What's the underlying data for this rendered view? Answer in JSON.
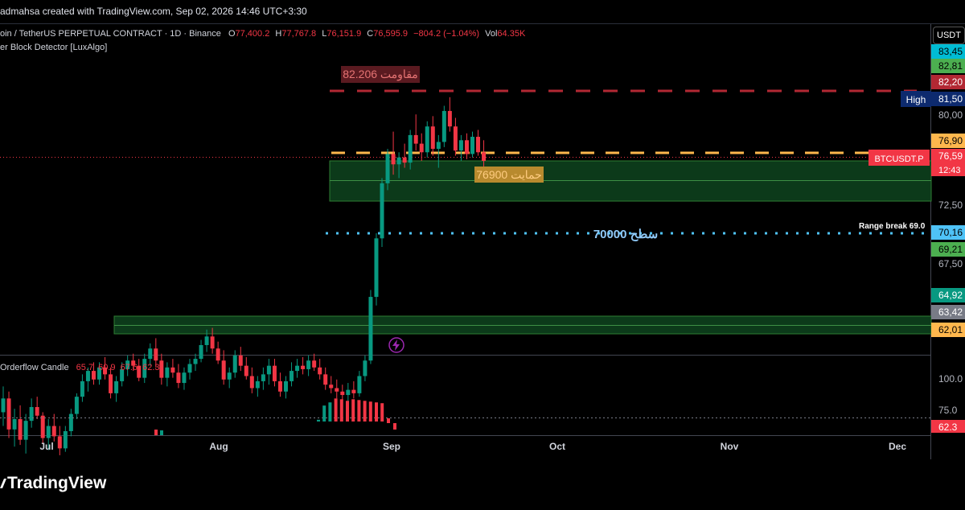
{
  "header": {
    "credit": "admahsa created with TradingView.com, Sep 02, 2026 14:46 UTC+3:30"
  },
  "symbol_line": {
    "title": "oin / TetherUS PERPETUAL CONTRACT · 1D · Binance",
    "o_label": "O",
    "o_value": "77,400.2",
    "h_label": "H",
    "h_value": "77,767.8",
    "l_label": "L",
    "l_value": "76,151.9",
    "c_label": "C",
    "c_value": "76,595.9",
    "change": "−804.2 (−1.04%)",
    "vol_label": "Vol",
    "vol_value": "64.35K"
  },
  "indicator1": {
    "name": "er Block Detector [LuxAlgo]"
  },
  "currency_button": "USDT",
  "annotations": {
    "resistance": "مقاومت 82.206",
    "support": "حمایت 76900",
    "level": "سطح 70000",
    "range_break": "Range break 69.0",
    "high": "High",
    "symbol_tag": "BTCUSDT.P",
    "countdown": "12:43"
  },
  "price_axis": {
    "labels": [
      {
        "text": "83,45",
        "bg": "#00bcd4",
        "fg": "#000000"
      },
      {
        "text": "82,81",
        "bg": "#4caf50",
        "fg": "#000000"
      },
      {
        "text": "82,20",
        "bg": "#b22833",
        "fg": "#ffffff"
      },
      {
        "text": "81,50",
        "bg": "#0d2a6e",
        "fg": "#ffffff"
      },
      {
        "text": "80,00",
        "bg": "",
        "fg": "#b2b5be"
      },
      {
        "text": "76,90",
        "bg": "#ffb74d",
        "fg": "#000000"
      },
      {
        "text": "76,59",
        "bg": "#f23645",
        "fg": "#ffffff"
      },
      {
        "text": "72,50",
        "bg": "",
        "fg": "#b2b5be"
      },
      {
        "text": "70,16",
        "bg": "#4fc3f7",
        "fg": "#000000"
      },
      {
        "text": "69,21",
        "bg": "#4caf50",
        "fg": "#000000"
      },
      {
        "text": "67,50",
        "bg": "",
        "fg": "#b2b5be"
      },
      {
        "text": "64,92",
        "bg": "#089981",
        "fg": "#ffffff"
      },
      {
        "text": "63,42",
        "bg": "#787b86",
        "fg": "#ffffff"
      },
      {
        "text": "62,01",
        "bg": "#ffb74d",
        "fg": "#000000"
      }
    ]
  },
  "lower_pane": {
    "name": "Orderflow Candle",
    "values": [
      "65.7",
      "60.9",
      "67.6",
      "62.3"
    ],
    "axis": [
      "100.0",
      "75.0"
    ],
    "last_value": "62.3"
  },
  "time_axis": [
    "Jul",
    "Aug",
    "Sep",
    "Oct",
    "Nov",
    "Dec"
  ],
  "brand": "TradingView",
  "colors": {
    "bull": "#089981",
    "bear": "#f23645",
    "resistance": "#b22833",
    "support": "#ffb74d",
    "level": "#4fc3f7",
    "zone": "#0c3a1a"
  },
  "icons": {
    "event": "lightning-icon"
  },
  "candles": [
    [
      62.0,
      63.5,
      61.2,
      62.8
    ],
    [
      62.8,
      63.2,
      60.5,
      61.0
    ],
    [
      61.0,
      62.2,
      60.0,
      61.6
    ],
    [
      61.6,
      62.4,
      60.1,
      60.4
    ],
    [
      60.4,
      61.9,
      59.6,
      61.5
    ],
    [
      61.5,
      62.8,
      61.1,
      62.3
    ],
    [
      62.3,
      62.9,
      61.6,
      61.8
    ],
    [
      61.8,
      62.0,
      60.2,
      60.5
    ],
    [
      60.5,
      61.6,
      59.8,
      61.2
    ],
    [
      61.2,
      61.9,
      60.3,
      60.6
    ],
    [
      60.6,
      61.2,
      59.5,
      59.9
    ],
    [
      59.9,
      61.2,
      59.7,
      60.9
    ],
    [
      60.9,
      62.2,
      60.6,
      61.9
    ],
    [
      61.9,
      63.1,
      61.6,
      62.9
    ],
    [
      62.9,
      64.2,
      62.6,
      63.8
    ],
    [
      63.8,
      64.6,
      63.2,
      64.4
    ],
    [
      64.4,
      64.9,
      63.6,
      63.9
    ],
    [
      63.9,
      64.9,
      63.6,
      64.6
    ],
    [
      64.6,
      65.2,
      63.9,
      64.2
    ],
    [
      64.2,
      64.6,
      62.8,
      63.1
    ],
    [
      63.1,
      64.1,
      62.6,
      63.8
    ],
    [
      63.8,
      64.9,
      63.5,
      64.5
    ],
    [
      64.5,
      65.3,
      64.1,
      65.0
    ],
    [
      65.0,
      65.4,
      64.4,
      64.7
    ],
    [
      64.7,
      65.1,
      63.8,
      64.0
    ],
    [
      64.0,
      65.4,
      63.7,
      65.1
    ],
    [
      65.1,
      66.0,
      64.7,
      65.7
    ],
    [
      65.7,
      66.3,
      64.6,
      65.0
    ],
    [
      65.0,
      65.4,
      63.6,
      64.0
    ],
    [
      64.0,
      64.9,
      63.5,
      64.6
    ],
    [
      64.6,
      65.1,
      64.0,
      64.3
    ],
    [
      64.3,
      64.8,
      63.4,
      63.7
    ],
    [
      63.7,
      64.6,
      63.3,
      64.3
    ],
    [
      64.3,
      65.1,
      63.9,
      64.8
    ],
    [
      64.8,
      65.4,
      64.4,
      65.1
    ],
    [
      65.1,
      66.2,
      64.9,
      65.9
    ],
    [
      65.9,
      66.8,
      65.5,
      66.4
    ],
    [
      66.4,
      66.9,
      65.4,
      65.7
    ],
    [
      65.7,
      66.1,
      64.8,
      65.0
    ],
    [
      65.0,
      65.6,
      63.6,
      63.9
    ],
    [
      63.9,
      64.6,
      63.4,
      64.3
    ],
    [
      64.3,
      65.6,
      64.0,
      65.3
    ],
    [
      65.3,
      65.8,
      64.4,
      64.7
    ],
    [
      64.7,
      65.2,
      63.9,
      64.1
    ],
    [
      64.1,
      64.6,
      63.1,
      63.4
    ],
    [
      63.4,
      64.1,
      62.9,
      63.8
    ],
    [
      63.8,
      64.6,
      63.3,
      64.2
    ],
    [
      64.2,
      65.1,
      63.6,
      64.7
    ],
    [
      64.7,
      65.1,
      63.5,
      63.8
    ],
    [
      63.8,
      64.3,
      62.9,
      63.2
    ],
    [
      63.2,
      64.1,
      62.8,
      63.8
    ],
    [
      63.8,
      64.9,
      63.5,
      64.4
    ],
    [
      64.4,
      65.1,
      64.0,
      64.7
    ],
    [
      64.7,
      65.2,
      64.2,
      64.5
    ],
    [
      64.5,
      65.3,
      64.1,
      65.0
    ],
    [
      65.0,
      65.4,
      64.4,
      64.6
    ],
    [
      64.6,
      65.1,
      63.9,
      64.2
    ],
    [
      64.2,
      64.6,
      63.3,
      63.6
    ],
    [
      63.6,
      64.1,
      63.1,
      63.4
    ],
    [
      63.4,
      63.9,
      62.8,
      63.2
    ],
    [
      63.2,
      63.6,
      62.6,
      63.0
    ],
    [
      63.0,
      63.7,
      62.6,
      63.3
    ],
    [
      63.3,
      63.8,
      62.8,
      63.1
    ],
    [
      63.1,
      64.4,
      62.9,
      64.1
    ],
    [
      64.1,
      65.3,
      63.8,
      65.0
    ],
    [
      65.0,
      69.1,
      64.8,
      68.7
    ],
    [
      68.7,
      72.4,
      68.2,
      72.1
    ],
    [
      72.1,
      75.6,
      71.6,
      75.3
    ],
    [
      75.3,
      77.3,
      74.9,
      77.0
    ],
    [
      77.0,
      78.3,
      75.8,
      76.4
    ],
    [
      76.4,
      77.1,
      75.6,
      76.8
    ],
    [
      76.8,
      77.6,
      76.2,
      76.5
    ],
    [
      76.5,
      78.4,
      76.1,
      78.1
    ],
    [
      78.1,
      79.3,
      77.2,
      77.6
    ],
    [
      77.6,
      78.2,
      76.6,
      77.1
    ],
    [
      77.1,
      78.9,
      76.8,
      78.6
    ],
    [
      78.6,
      79.2,
      76.9,
      77.3
    ],
    [
      77.3,
      78.1,
      76.2,
      77.7
    ],
    [
      77.7,
      79.8,
      77.4,
      79.5
    ],
    [
      79.5,
      80.3,
      78.3,
      78.6
    ],
    [
      78.6,
      79.1,
      76.9,
      77.2
    ],
    [
      77.2,
      78.1,
      76.6,
      77.8
    ],
    [
      77.8,
      78.2,
      76.7,
      77.0
    ],
    [
      77.0,
      78.3,
      76.8,
      78.0
    ],
    [
      78.0,
      78.4,
      76.9,
      77.1
    ],
    [
      77.1,
      77.8,
      76.1,
      76.6
    ]
  ],
  "osc": [
    [
      "b",
      40
    ],
    [
      "b",
      58
    ],
    [
      "g",
      62
    ],
    [
      "r",
      67
    ],
    [
      "r",
      66
    ],
    [
      "r",
      64
    ],
    [
      "r",
      66
    ],
    [
      "r",
      65
    ],
    [
      "r",
      64
    ],
    [
      "r",
      63
    ],
    [
      "r",
      62
    ],
    [
      "r",
      61
    ]
  ]
}
